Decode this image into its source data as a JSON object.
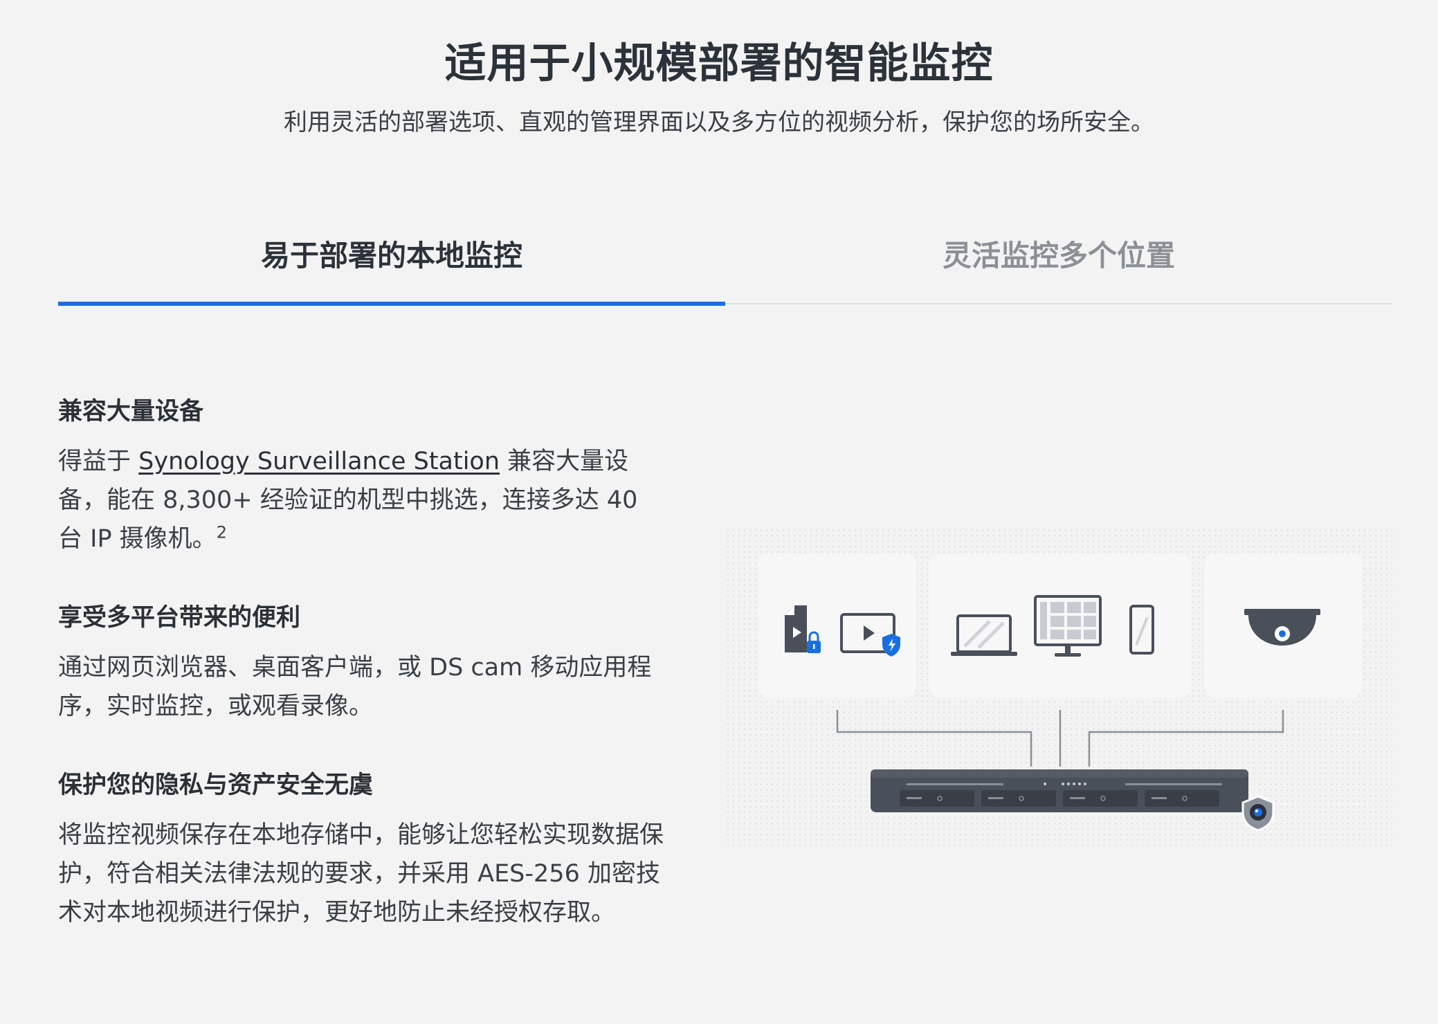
{
  "header": {
    "title": "适用于小规模部署的智能监控",
    "subtitle": "利用灵活的部署选项、直观的管理界面以及多方位的视频分析，保护您的场所安全。"
  },
  "tabs": [
    {
      "label": "易于部署的本地监控",
      "active": true
    },
    {
      "label": "灵活监控多个位置",
      "active": false
    }
  ],
  "features": [
    {
      "heading": "兼容大量设备",
      "body_prefix": "得益于 ",
      "link_text": "Synology Surveillance Station",
      "body_suffix": " 兼容大量设备，能在 8,300+ 经验证的机型中挑选，连接多达 40 台 IP 摄像机。",
      "footnote": "2"
    },
    {
      "heading": "享受多平台带来的便利",
      "body": "通过网页浏览器、桌面客户端，或 DS cam 移动应用程序，实时监控，或观看录像。"
    },
    {
      "heading": "保护您的隐私与资产安全无虞",
      "body": "将监控视频保存在本地存储中，能够让您轻松实现数据保护，符合相关法律法规的要求，并采用 AES-256 加密技术对本地视频进行保护，更好地防止未经授权存取。"
    }
  ],
  "illustration": {
    "icons": [
      "locked-file-icon",
      "protected-video-icon",
      "laptop-icon",
      "monitor-icon",
      "phone-icon",
      "dome-camera-icon",
      "nas-device-icon",
      "surveillance-badge-icon"
    ],
    "colors": {
      "accent": "#1a6fe0",
      "device": "#4a505a",
      "panel": "#f7f7f8",
      "line": "#8a9099"
    }
  }
}
